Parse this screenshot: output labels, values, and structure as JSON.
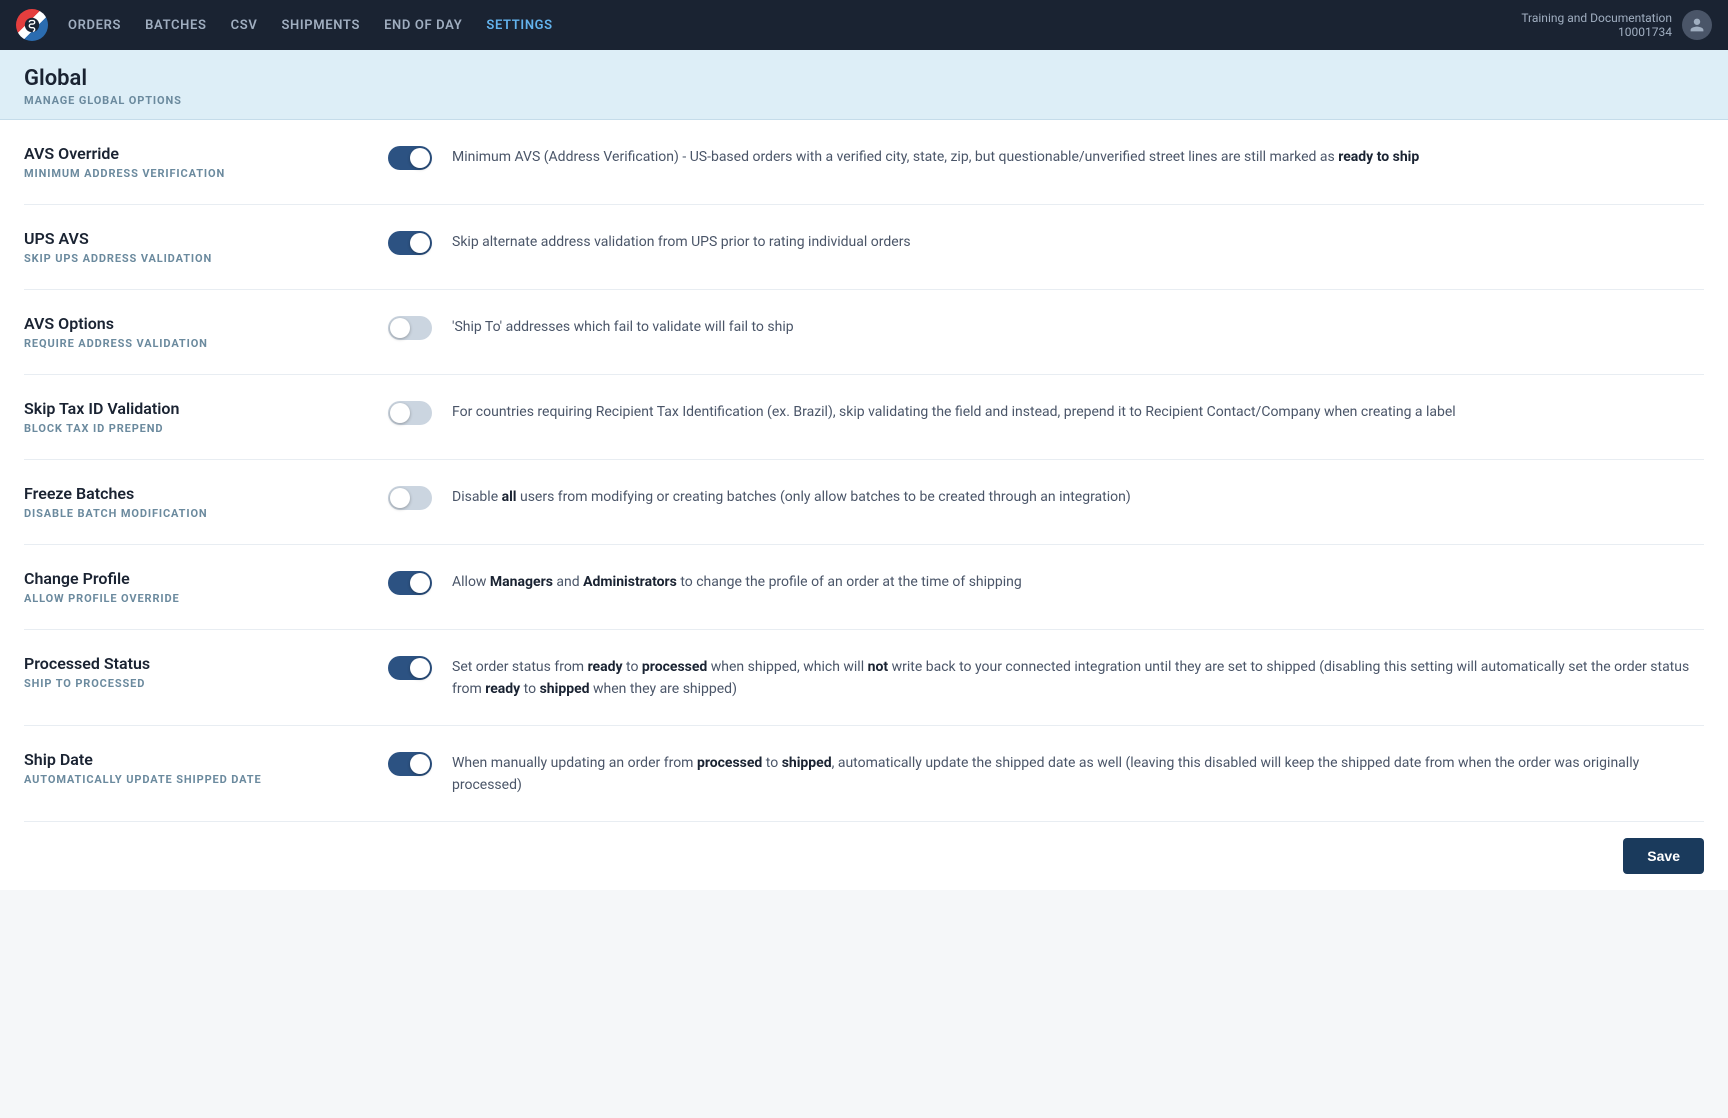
{
  "nav": {
    "logo_label": "S",
    "items": [
      {
        "label": "ORDERS",
        "active": false
      },
      {
        "label": "BATCHES",
        "active": false
      },
      {
        "label": "CSV",
        "active": false
      },
      {
        "label": "SHIPMENTS",
        "active": false
      },
      {
        "label": "END OF DAY",
        "active": false
      },
      {
        "label": "SETTINGS",
        "active": true
      }
    ],
    "user_name": "Training and Documentation",
    "user_id": "10001734"
  },
  "page": {
    "title": "Global",
    "subtitle": "MANAGE GLOBAL OPTIONS"
  },
  "settings": [
    {
      "name": "AVS Override",
      "key": "MINIMUM ADDRESS VERIFICATION",
      "enabled": true,
      "description_parts": [
        {
          "text": "Minimum AVS (Address Verification) - US-based orders with a verified city, state, zip, but questionable/unverified street lines are still marked as ",
          "bold": false
        },
        {
          "text": "ready to ship",
          "bold": true
        }
      ]
    },
    {
      "name": "UPS AVS",
      "key": "SKIP UPS ADDRESS VALIDATION",
      "enabled": true,
      "description_parts": [
        {
          "text": "Skip alternate address validation from UPS prior to rating individual orders",
          "bold": false
        }
      ]
    },
    {
      "name": "AVS Options",
      "key": "REQUIRE ADDRESS VALIDATION",
      "enabled": false,
      "description_parts": [
        {
          "text": "'Ship To' addresses which fail to validate will fail to ship",
          "bold": false
        }
      ]
    },
    {
      "name": "Skip Tax ID Validation",
      "key": "BLOCK TAX ID PREPEND",
      "enabled": false,
      "description_parts": [
        {
          "text": "For countries requiring Recipient Tax Identification (ex. Brazil), skip validating the field and instead, prepend it to Recipient Contact/Company when creating a label",
          "bold": false
        }
      ]
    },
    {
      "name": "Freeze Batches",
      "key": "DISABLE BATCH MODIFICATION",
      "enabled": false,
      "description_parts": [
        {
          "text": "Disable ",
          "bold": false
        },
        {
          "text": "all",
          "bold": true
        },
        {
          "text": " users from modifying or creating batches (only allow batches to be created through an integration)",
          "bold": false
        }
      ]
    },
    {
      "name": "Change Profile",
      "key": "ALLOW PROFILE OVERRIDE",
      "enabled": true,
      "description_parts": [
        {
          "text": "Allow ",
          "bold": false
        },
        {
          "text": "Managers",
          "bold": true
        },
        {
          "text": " and ",
          "bold": false
        },
        {
          "text": "Administrators",
          "bold": true
        },
        {
          "text": " to change the profile of an order at the time of shipping",
          "bold": false
        }
      ]
    },
    {
      "name": "Processed Status",
      "key": "SHIP TO PROCESSED",
      "enabled": true,
      "description_parts": [
        {
          "text": "Set order status from ",
          "bold": false
        },
        {
          "text": "ready",
          "bold": true
        },
        {
          "text": " to ",
          "bold": false
        },
        {
          "text": "processed",
          "bold": true
        },
        {
          "text": " when shipped, which will ",
          "bold": false
        },
        {
          "text": "not",
          "bold": true
        },
        {
          "text": " write back to your connected integration until they are set to shipped (disabling this setting will automatically set the order status from ",
          "bold": false
        },
        {
          "text": "ready",
          "bold": true
        },
        {
          "text": " to ",
          "bold": false
        },
        {
          "text": "shipped",
          "bold": true
        },
        {
          "text": " when they are shipped)",
          "bold": false
        }
      ]
    },
    {
      "name": "Ship Date",
      "key": "AUTOMATICALLY UPDATE SHIPPED DATE",
      "enabled": true,
      "description_parts": [
        {
          "text": "When manually updating an order from ",
          "bold": false
        },
        {
          "text": "processed",
          "bold": true
        },
        {
          "text": " to ",
          "bold": false
        },
        {
          "text": "shipped",
          "bold": true
        },
        {
          "text": ", automatically update the shipped date as well (leaving this disabled will keep the shipped date from when the order was originally processed)",
          "bold": false
        }
      ]
    }
  ],
  "save_button": "Save"
}
